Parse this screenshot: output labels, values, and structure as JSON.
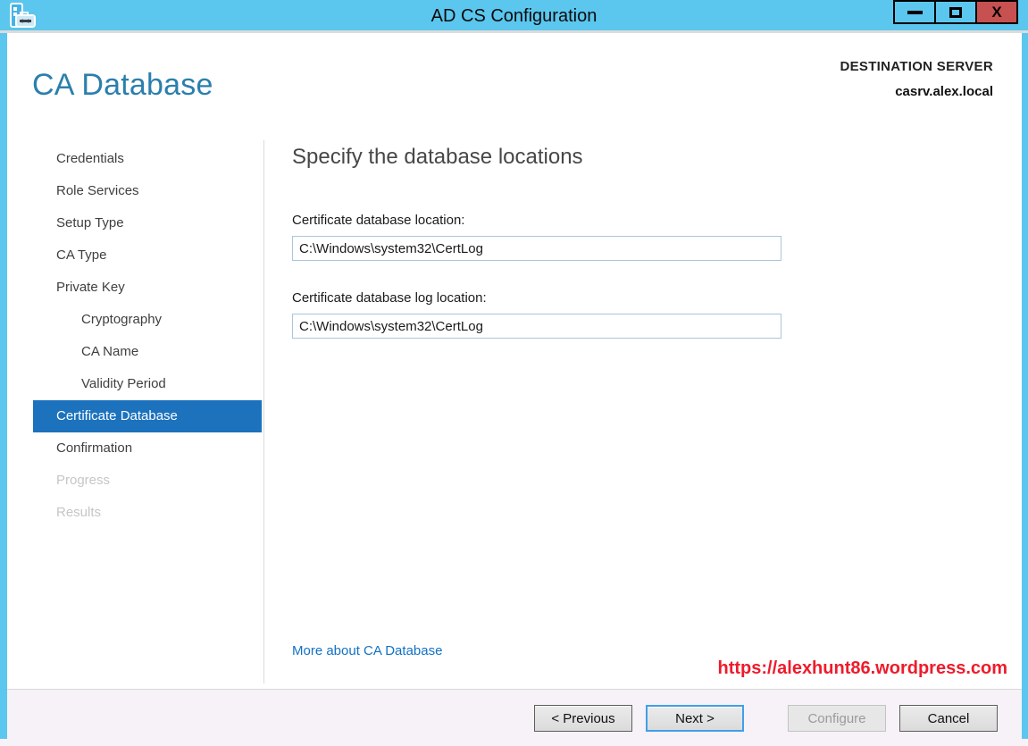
{
  "window": {
    "title": "AD CS Configuration",
    "controls": {
      "minimize": "minimize",
      "maximize": "maximize",
      "close_glyph": "X"
    }
  },
  "header": {
    "page_title": "CA Database",
    "destination_label": "DESTINATION SERVER",
    "destination_server": "casrv.alex.local"
  },
  "sidebar": {
    "items": [
      {
        "label": "Credentials",
        "indent": 0,
        "state": "normal"
      },
      {
        "label": "Role Services",
        "indent": 0,
        "state": "normal"
      },
      {
        "label": "Setup Type",
        "indent": 0,
        "state": "normal"
      },
      {
        "label": "CA Type",
        "indent": 0,
        "state": "normal"
      },
      {
        "label": "Private Key",
        "indent": 0,
        "state": "normal"
      },
      {
        "label": "Cryptography",
        "indent": 1,
        "state": "normal"
      },
      {
        "label": "CA Name",
        "indent": 1,
        "state": "normal"
      },
      {
        "label": "Validity Period",
        "indent": 1,
        "state": "normal"
      },
      {
        "label": "Certificate Database",
        "indent": 0,
        "state": "selected"
      },
      {
        "label": "Confirmation",
        "indent": 0,
        "state": "normal"
      },
      {
        "label": "Progress",
        "indent": 0,
        "state": "disabled"
      },
      {
        "label": "Results",
        "indent": 0,
        "state": "disabled"
      }
    ]
  },
  "main": {
    "heading": "Specify the database locations",
    "fields": [
      {
        "label": "Certificate database location:",
        "value": "C:\\Windows\\system32\\CertLog"
      },
      {
        "label": "Certificate database log location:",
        "value": "C:\\Windows\\system32\\CertLog"
      }
    ],
    "link_label": "More about CA Database"
  },
  "watermark": {
    "text": "https://alexhunt86.wordpress.com"
  },
  "footer": {
    "buttons": [
      {
        "label": "< Previous",
        "state": "enabled"
      },
      {
        "label": "Next >",
        "state": "default"
      },
      {
        "label": "Configure",
        "state": "disabled"
      },
      {
        "label": "Cancel",
        "state": "enabled"
      }
    ]
  },
  "colors": {
    "titlebar": "#5BC6EE",
    "close_button": "#C75050",
    "selection": "#1C72BD",
    "page_title": "#2B7FAD",
    "link": "#1271C4",
    "watermark": "#EE1B2B",
    "footer_bg": "#F7F2F7"
  }
}
